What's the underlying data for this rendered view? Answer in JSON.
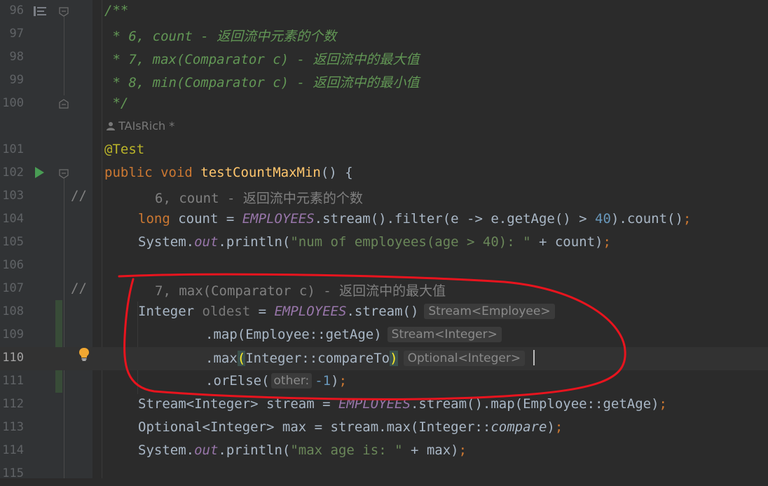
{
  "editor": {
    "author_hint": "TAIsRich *",
    "lines": [
      {
        "num": "96",
        "top": 0
      },
      {
        "num": "97"
      },
      {
        "num": "98"
      },
      {
        "num": "99"
      },
      {
        "num": "100"
      },
      {
        "num": "101"
      },
      {
        "num": "102"
      },
      {
        "num": "103"
      },
      {
        "num": "104"
      },
      {
        "num": "105"
      },
      {
        "num": "106"
      },
      {
        "num": "107"
      },
      {
        "num": "108"
      },
      {
        "num": "109"
      },
      {
        "num": "110"
      },
      {
        "num": "111"
      },
      {
        "num": "112"
      },
      {
        "num": "113"
      },
      {
        "num": "114"
      },
      {
        "num": "115"
      }
    ],
    "code": {
      "l96": "/**",
      "l97": " * 6, count - 返回流中元素的个数",
      "l98": " * 7, max(Comparator c) - 返回流中的最大值",
      "l99": " * 8, min(Comparator c) - 返回流中的最小值",
      "l100": " */",
      "l101": "@Test",
      "l102_kw": "public void ",
      "l102_fn": "testCountMaxMin",
      "l102_rest": "() {",
      "l103_mark": "//",
      "l103_text": "6, count - 返回流中元素的个数",
      "l104_kw": "long ",
      "l104_a": "count = ",
      "l104_stat": "EMPLOYEES",
      "l104_b": ".stream().filter(e -> e.getAge() > ",
      "l104_num": "40",
      "l104_c": ").count()",
      "l104_semi": ";",
      "l105_a": "System.",
      "l105_stat": "out",
      "l105_b": ".println(",
      "l105_str": "\"num of employees(age > 40): \"",
      "l105_c": " + count)",
      "l105_semi": ";",
      "l107_mark": "//",
      "l107_text": "7, max(Comparator c) - 返回流中的最大值",
      "l108_a": "Integer ",
      "l108_var": "oldest",
      "l108_b": " = ",
      "l108_stat": "EMPLOYEES",
      "l108_c": ".stream()",
      "l108_hint": "Stream<Employee>",
      "l109_a": ".map(Employee::getAge)",
      "l109_hint": "Stream<Integer>",
      "l110_a": ".max",
      "l110_open": "(",
      "l110_b": "Integer::compareTo",
      "l110_close": ")",
      "l110_hint": "Optional<Integer>",
      "l111_a": ".orElse(",
      "l111_hint": "other:",
      "l111_num": "-1",
      "l111_b": ")",
      "l111_semi": ";",
      "l112_a": "Stream<Integer> stream = ",
      "l112_stat": "EMPLOYEES",
      "l112_b": ".stream().map(Employee::getAge)",
      "l112_semi": ";",
      "l113_a": "Optional<Integer> max = stream.max(Integer::",
      "l113_ital": "compare",
      "l113_b": ")",
      "l113_semi": ";",
      "l114_a": "System.",
      "l114_stat": "out",
      "l114_b": ".println(",
      "l114_str": "\"max age is: \"",
      "l114_c": " + max)",
      "l114_semi": ";"
    },
    "icons": [
      "list-icon",
      "fold-icon",
      "run-icon",
      "bulb-icon"
    ],
    "annotation_color": "#e8141e"
  }
}
